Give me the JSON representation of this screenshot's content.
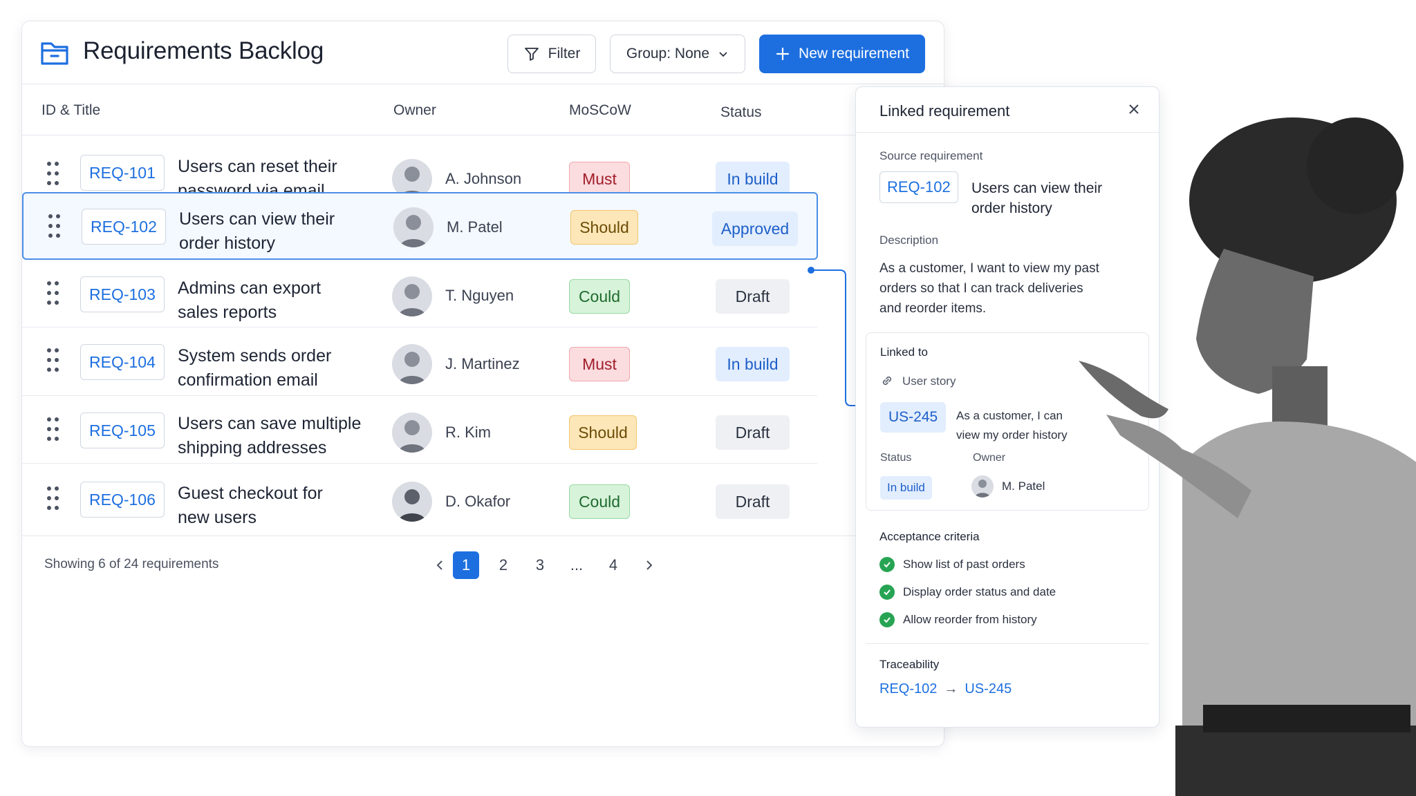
{
  "header": {
    "title": "Requirements Backlog",
    "filter_label": "Filter",
    "group_label": "Group: None",
    "new_label": "New requirement"
  },
  "table": {
    "columns": [
      "ID & Title",
      "Owner",
      "MoSCoW",
      "Status"
    ],
    "rows": [
      {
        "id": "REQ-101",
        "title_line1": "Users can reset their",
        "title_line2": "password via email",
        "owner": "A. Johnson",
        "moscow": "Must",
        "status": "In build"
      },
      {
        "id": "REQ-102",
        "title_line1": "Users can view their",
        "title_line2": "order history",
        "owner": "M. Patel",
        "moscow": "Should",
        "status": "Approved"
      },
      {
        "id": "REQ-103",
        "title_line1": "Admins can export",
        "title_line2": "sales reports",
        "owner": "T. Nguyen",
        "moscow": "Could",
        "status": "Draft"
      },
      {
        "id": "REQ-104",
        "title_line1": "System sends order",
        "title_line2": "confirmation email",
        "owner": "J. Martinez",
        "moscow": "Must",
        "status": "In build"
      },
      {
        "id": "REQ-105",
        "title_line1": "Users can save multiple",
        "title_line2": "shipping addresses",
        "owner": "R. Kim",
        "moscow": "Should",
        "status": "Draft"
      },
      {
        "id": "REQ-106",
        "title_line1": "Guest checkout for",
        "title_line2": "new users",
        "owner": "D. Okafor",
        "moscow": "Could",
        "status": "Draft"
      }
    ],
    "selected_row": "REQ-102"
  },
  "footer": {
    "showing": "Showing 6 of 24 requirements",
    "pages": [
      "1",
      "2",
      "3",
      "...",
      "4"
    ],
    "current_page": "1",
    "prev_icon": "chevron-left-icon",
    "next_icon": "chevron-right-icon"
  },
  "panel": {
    "title": "Linked requirement",
    "source_label": "Source requirement",
    "source_id": "REQ-102",
    "source_title_line1": "Users can view their",
    "source_title_line2": "order history",
    "description_label": "Description",
    "description_line1": "As a customer, I want to view my past",
    "description_line2": "orders so that I can track deliveries",
    "description_line3": "and reorder items.",
    "linked_label": "Linked to",
    "link_type": "User story",
    "linked_id": "US-245",
    "linked_text_line1": "As a customer, I can",
    "linked_text_line2": "view my order history",
    "status_label": "Status",
    "status_value": "In build",
    "owner_label": "Owner",
    "owner_value": "M. Patel",
    "ac_label": "Acceptance criteria",
    "criteria": [
      "Show list of past orders",
      "Display order status and date",
      "Allow reorder from history"
    ],
    "trace_label": "Traceability",
    "trace_from": "REQ-102",
    "trace_arrow": "→",
    "trace_to": "US-245"
  },
  "colors": {
    "accent": "#1d6fe0",
    "must": "#fbdcdf",
    "should": "#fde7b8",
    "could": "#d7f3da",
    "status_blue": "#e2edfd",
    "draft": "#eef0f3",
    "check": "#27a453"
  }
}
